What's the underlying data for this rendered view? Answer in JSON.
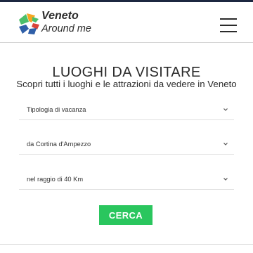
{
  "header": {
    "brand_title": "Veneto",
    "brand_subtitle": "Around me",
    "logo_icon": "veneto-flower-logo-icon",
    "menu_icon": "hamburger-menu-icon"
  },
  "main": {
    "title": "LUOGHI DA VISITARE",
    "subtitle": "Scopri tutti i luoghi e le attrazioni da vedere in Veneto"
  },
  "filters": [
    {
      "label": "Tipologia di vacanza"
    },
    {
      "label": "da Cortina d'Ampezzo"
    },
    {
      "label": "nel raggio di 40 Km"
    }
  ],
  "search_button": {
    "label": "CERCA"
  },
  "colors": {
    "accent_green": "#2ac65e",
    "logo_green": "#4bbf6a",
    "logo_orange": "#f5a623",
    "logo_blue": "#2f5fa8",
    "logo_red": "#d8433a",
    "top_strip": "#1c2740"
  }
}
